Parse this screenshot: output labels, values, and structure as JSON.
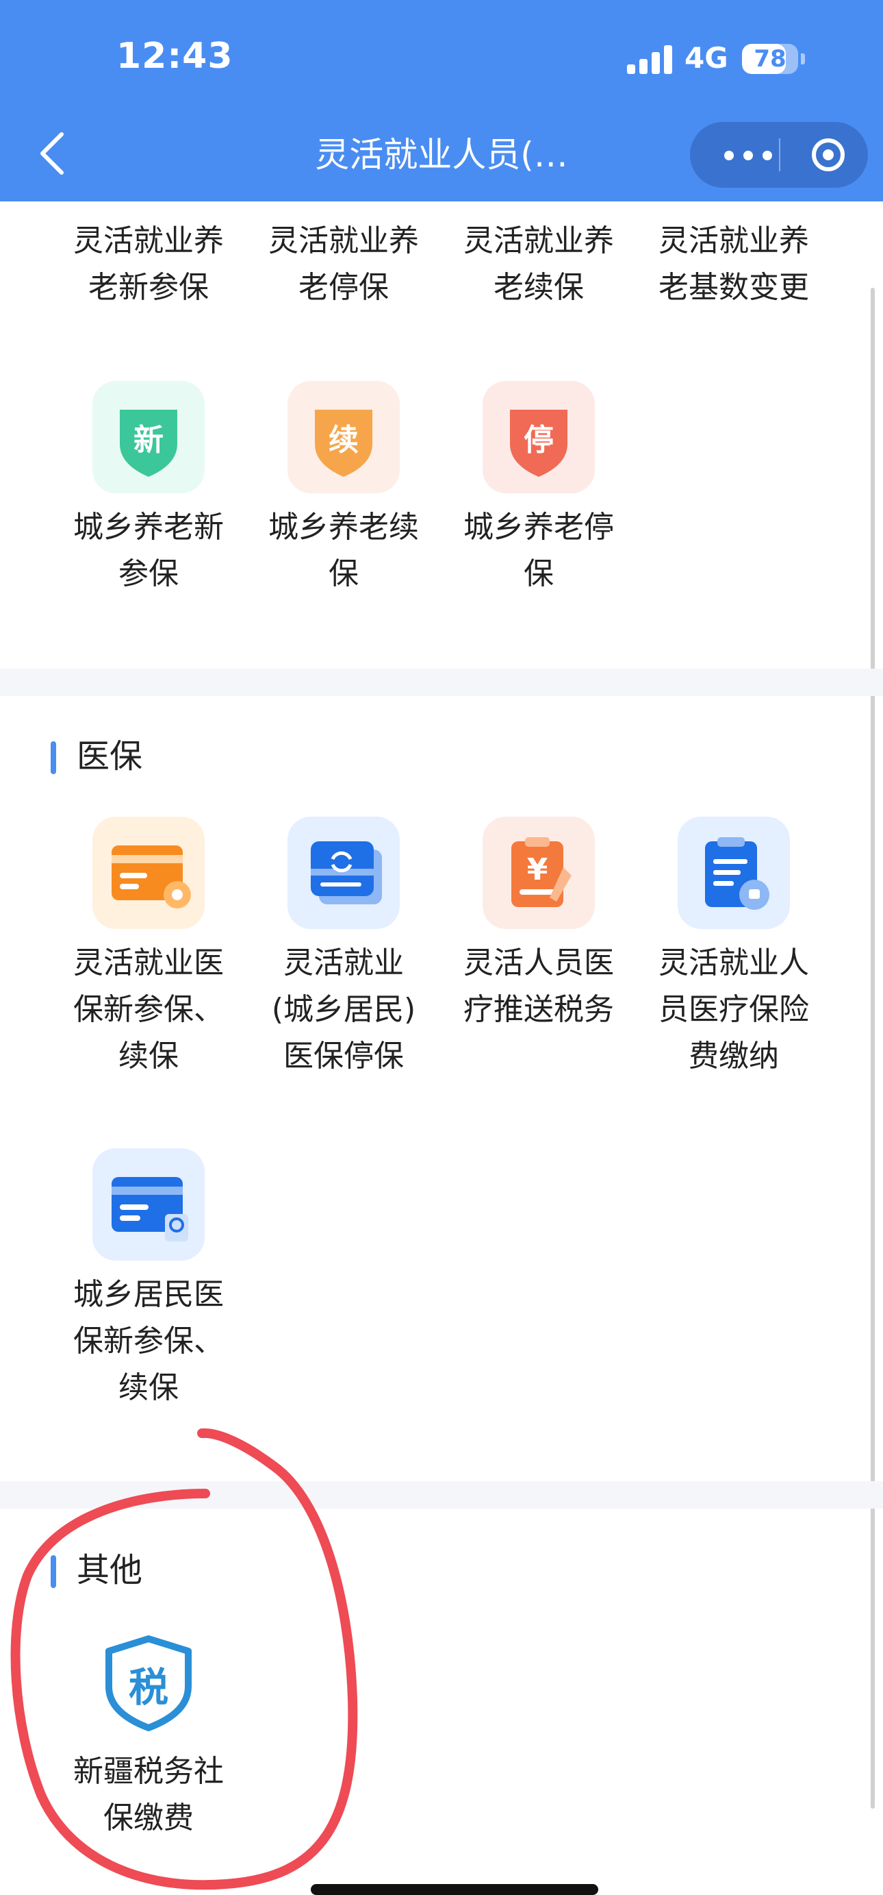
{
  "status_bar": {
    "time": "12:43",
    "network": "4G",
    "battery": "78"
  },
  "nav": {
    "title": "灵活就业人员(…",
    "back_icon": "chevron-left-icon",
    "more_icon": "more-dots-icon",
    "close_icon": "target-circle-icon"
  },
  "pension": {
    "top_row": [
      "灵活就业养\n老新参保",
      "灵活就业养\n老停保",
      "灵活就业养\n老续保",
      "灵活就业养\n老基数变更"
    ],
    "items": [
      {
        "label": "城乡养老新\n参保",
        "icon_text": "新",
        "icon": "shield-new-icon",
        "color": "#3cc79a",
        "bg": "#e8faf4"
      },
      {
        "label": "城乡养老续\n保",
        "icon_text": "续",
        "icon": "shield-continue-icon",
        "color": "#f7a54a",
        "bg": "#fdeee7"
      },
      {
        "label": "城乡养老停\n保",
        "icon_text": "停",
        "icon": "shield-stop-icon",
        "color": "#f06a55",
        "bg": "#fdeae6"
      }
    ]
  },
  "medical": {
    "title": "医保",
    "items": [
      {
        "label": "灵活就业医\n保新参保、\n续保",
        "icon": "card-gear-icon"
      },
      {
        "label": "灵活就业\n(城乡居民)\n医保停保",
        "icon": "card-refresh-icon"
      },
      {
        "label": "灵活人员医\n疗推送税务",
        "icon": "clipboard-yuan-icon"
      },
      {
        "label": "灵活就业人\n员医疗保险\n费缴纳",
        "icon": "clipboard-stamp-icon"
      },
      {
        "label": "城乡居民医\n保新参保、\n续保",
        "icon": "card-search-icon"
      }
    ]
  },
  "other": {
    "title": "其他",
    "items": [
      {
        "label": "新疆税务社\n保缴费",
        "icon_text": "税",
        "icon": "tax-shield-icon"
      }
    ]
  },
  "colors": {
    "header": "#4a8df2",
    "accent": "#4a8df2",
    "annotation": "#ee4b55"
  }
}
